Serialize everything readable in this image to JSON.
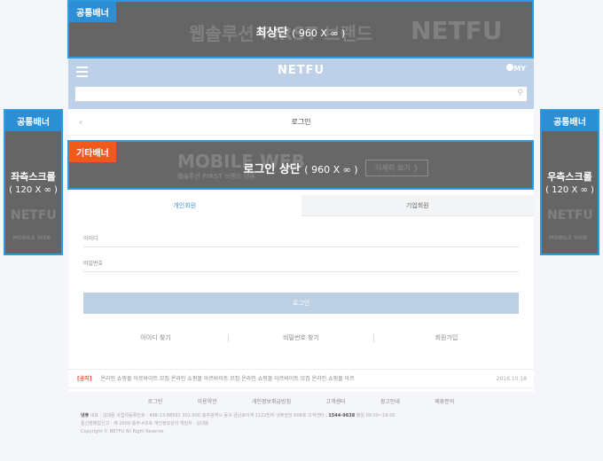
{
  "header": {
    "logo": "NETFU",
    "my_label": "MY"
  },
  "search": {
    "placeholder": ""
  },
  "page": {
    "title": "로그인",
    "back_symbol": "‹"
  },
  "tabs": [
    {
      "label": "개인회원"
    },
    {
      "label": "기업회원"
    }
  ],
  "form": {
    "id_placeholder": "아이디",
    "pw_placeholder": "비밀번호",
    "login_button": "로그인"
  },
  "links": [
    {
      "label": "아이디 찾기"
    },
    {
      "label": "비밀번호 찾기"
    },
    {
      "label": "회원가입"
    }
  ],
  "notice": {
    "label": "[공지]",
    "text": "온라인 쇼핑몰 아르바이트 모집 온라인 쇼핑몰 아르바이트 모집 온라인 쇼핑몰 아르바이트 모집 온라인 쇼핑몰 아르",
    "date": "2016.10.18"
  },
  "footer": {
    "nav": [
      "로그인",
      "이용약관",
      "개인정보취급방침",
      "고객센터",
      "광고안내",
      "제휴문의"
    ],
    "company": "넷퓨",
    "info_line1": "대표 : 김대용  사업자등록번호 : 498-13-88591  301-600 충주광역시 동구 금남로어게 1122번지 넷퓨빌딩 606호 고객센터 : ",
    "phone": "1544-9638",
    "info_line1_tail": " 평일 09:00~18:00",
    "info_line2": "통신판매업신고 : 제 2009-충주-4조호  개인정보관리 책임자 : 김대용",
    "copyright": "Copyright © NETFU All Right Reserve."
  },
  "overlays": {
    "top": {
      "tag": "공통배너",
      "caption": "최상단",
      "size": "( 960 X ∞ )",
      "bg1": "웹솔루션 FIRST 브랜드",
      "bg2": "NETFU"
    },
    "left": {
      "tag": "공통배너",
      "caption": "좌측스크롤",
      "size": "( 120 X ∞ )",
      "bg": "NETFU",
      "bg_btn": "MOBILE WEB"
    },
    "right": {
      "tag": "공통배너",
      "caption": "우측스크롤",
      "size": "( 120 X ∞ )",
      "bg": "NETFU",
      "bg_btn": "MOBILE WEB"
    },
    "login": {
      "tag": "기타배너",
      "caption": "로그인 상단",
      "size": "( 960 X ∞ )",
      "bg1": "MOBILE WEB",
      "bg2": "웹솔루션 FIRST 브랜드 넷퓨",
      "bg_btn": "자세히 보기 ❯"
    }
  }
}
